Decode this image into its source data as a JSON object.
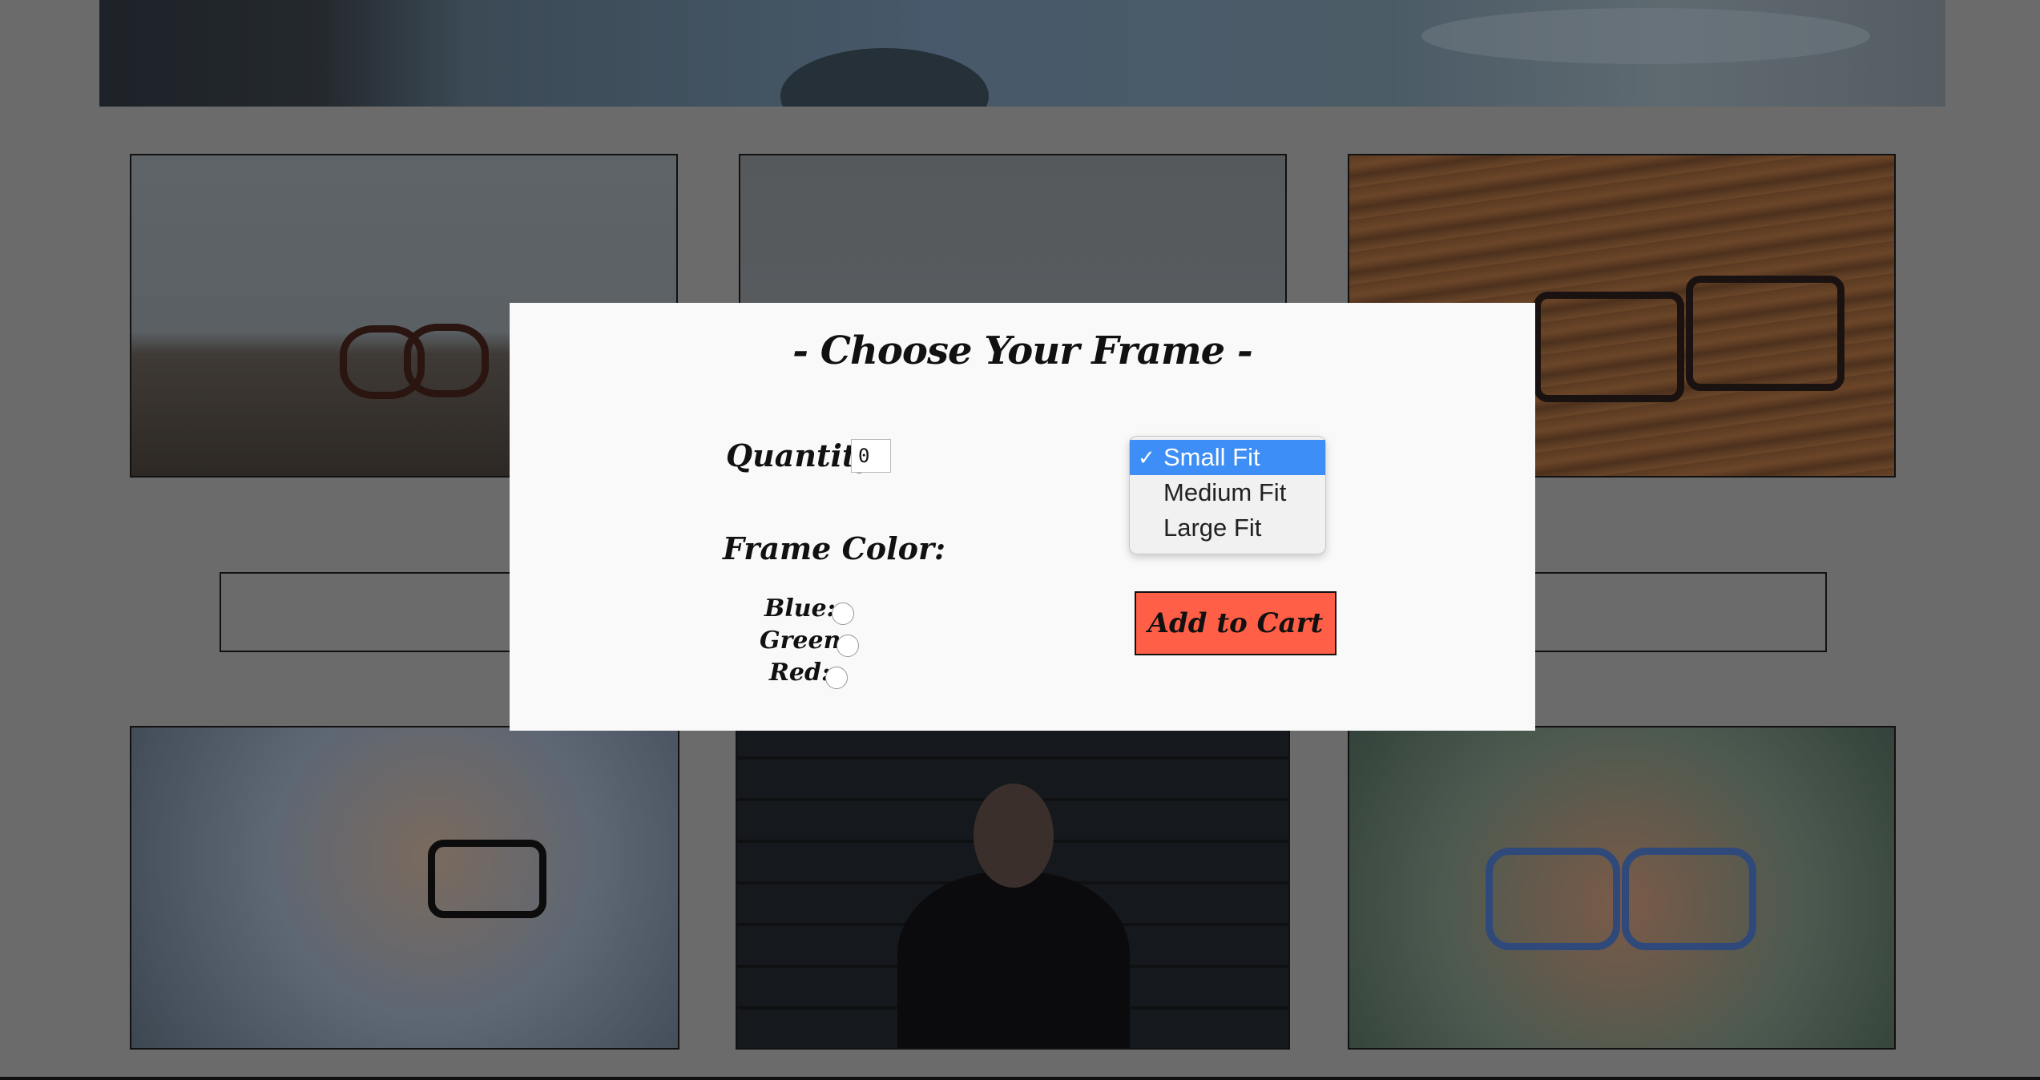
{
  "modal": {
    "title": "- Choose Your Frame -",
    "quantity_label": "Quantity:",
    "quantity_value": "0",
    "frame_color_label": "Frame Color:",
    "colors": [
      {
        "label": "Blue:"
      },
      {
        "label": "Green:"
      },
      {
        "label": "Red:"
      }
    ],
    "fit_options": [
      {
        "label": "Small Fit",
        "selected": true
      },
      {
        "label": "Medium Fit",
        "selected": false
      },
      {
        "label": "Large Fit",
        "selected": false
      }
    ],
    "checkmark": "✓",
    "add_to_cart_label": "Add to Cart"
  },
  "colors": {
    "overlay": "#6b6b6b",
    "modal_bg": "#f9f9f9",
    "button": "#fe5f46",
    "selection": "#3d8ef6"
  }
}
